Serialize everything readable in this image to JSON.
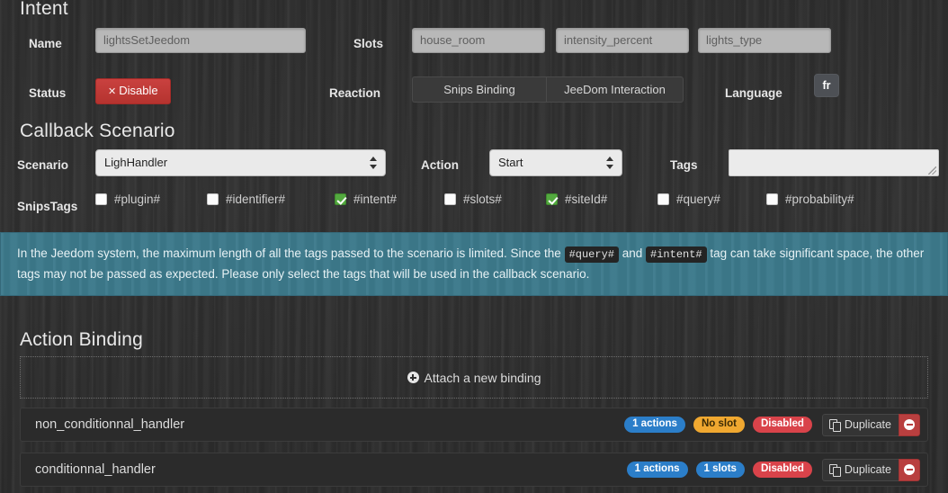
{
  "intent": {
    "title": "Intent",
    "name_label": "Name",
    "name_value": "lightsSetJeedom",
    "slots_label": "Slots",
    "slots": [
      "house_room",
      "intensity_percent",
      "lights_type"
    ],
    "status_label": "Status",
    "status_button": "Disable",
    "status_button_icon": "times-icon",
    "reaction_label": "Reaction",
    "reaction_options": [
      "Snips Binding",
      "JeeDom Interaction"
    ],
    "language_label": "Language",
    "language_value": "fr"
  },
  "callback": {
    "title": "Callback Scenario",
    "scenario_label": "Scenario",
    "scenario_value": "LighHandler",
    "action_label": "Action",
    "action_value": "Start",
    "tags_label": "Tags",
    "tags_value": "",
    "snipstags_label": "SnipsTags",
    "tags": [
      {
        "label": "#plugin#",
        "checked": false
      },
      {
        "label": "#identifier#",
        "checked": false
      },
      {
        "label": "#intent#",
        "checked": true
      },
      {
        "label": "#slots#",
        "checked": false
      },
      {
        "label": "#siteId#",
        "checked": true
      },
      {
        "label": "#query#",
        "checked": false
      },
      {
        "label": "#probability#",
        "checked": false
      }
    ]
  },
  "alert": {
    "part1": "In the Jeedom system, the maximum length of all the tags passed to the scenario is limited. Since the ",
    "code1": "#query#",
    "part2": " and ",
    "code2": "#intent#",
    "part3": " tag can take significant space, the other tags may not be passed as expected. Please only select the tags that will be used in the callback scenario."
  },
  "action_binding": {
    "title": "Action Binding",
    "attach_label": "Attach a new binding",
    "attach_icon": "plus-circle-icon",
    "rows": [
      {
        "name": "non_conditionnal_handler",
        "actions_badge": "1 actions",
        "slots_badge": "No slot",
        "slots_badge_color": "orange",
        "status_badge": "Disabled",
        "duplicate_label": "Duplicate",
        "duplicate_icon": "copy-icon",
        "remove_icon": "minus-circle-icon"
      },
      {
        "name": "conditionnal_handler",
        "actions_badge": "1 actions",
        "slots_badge": "1 slots",
        "slots_badge_color": "blue",
        "status_badge": "Disabled",
        "duplicate_label": "Duplicate",
        "duplicate_icon": "copy-icon",
        "remove_icon": "minus-circle-icon"
      }
    ]
  },
  "colors": {
    "accent_blue": "#2b7ec9",
    "accent_orange": "#f0a830",
    "accent_red": "#d9434a",
    "checkbox_green": "#53a93f",
    "alert_teal": "#3d7a8c",
    "background": "#2e2e2e"
  }
}
